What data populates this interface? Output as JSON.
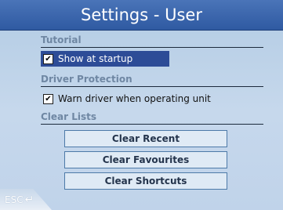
{
  "window": {
    "title": "Settings - User"
  },
  "sections": [
    {
      "title": "Tutorial",
      "checkbox": {
        "label": "Show at startup",
        "checked": true,
        "selected": true
      }
    },
    {
      "title": "Driver Protection",
      "checkbox": {
        "label": "Warn driver when operating unit",
        "checked": true,
        "selected": false
      }
    },
    {
      "title": "Clear Lists",
      "buttons": [
        "Clear Recent",
        "Clear Favourites",
        "Clear Shortcuts"
      ]
    }
  ],
  "checkmark_glyph": "✔",
  "footer": {
    "esc_label": "ESC",
    "esc_icon": "return-arrow-icon"
  },
  "colors": {
    "title_bg": "#2f5aa2",
    "panel_bg": "#c6d8ec",
    "selected_row": "#2d4c97",
    "section_title": "#6f87a3",
    "button_border": "#4d7aa8"
  }
}
